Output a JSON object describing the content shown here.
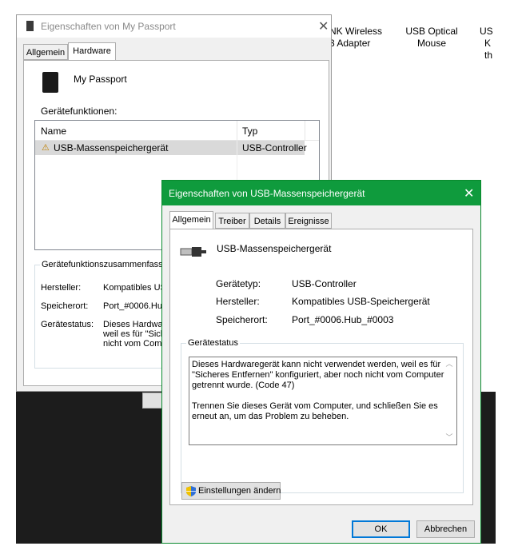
{
  "background": {
    "devices": [
      {
        "label_line1": "NK Wireless",
        "label_line2": "3 Adapter"
      },
      {
        "label_line1": "USB Optical",
        "label_line2": "Mouse"
      },
      {
        "label_line1": "US",
        "label_line2": "K",
        "label_line3": "th"
      }
    ]
  },
  "back_window": {
    "title": "Eigenschaften von My Passport",
    "tabs": [
      "Allgemein",
      "Hardware"
    ],
    "active_tab": "Hardware",
    "device_name": "My Passport",
    "functions_label": "Gerätefunktionen:",
    "columns": [
      "Name",
      "Typ"
    ],
    "rows": [
      {
        "name": "USB-Massenspeichergerät",
        "type": "USB-Controller"
      }
    ],
    "summary_title": "Gerätefunktionszusammenfassung",
    "summary": {
      "manufacturer_label": "Hersteller:",
      "manufacturer_value": "Kompatibles USB",
      "location_label": "Speicherort:",
      "location_value": "Port_#0006.Hub",
      "status_label": "Gerätestatus:",
      "status_line1": "Dieses Hardwa",
      "status_line2": "weil es für \"Siche",
      "status_line3": "nicht vom Comp"
    }
  },
  "front_window": {
    "title": "Eigenschaften von USB-Massenspeichergerät",
    "tabs": [
      "Allgemein",
      "Treiber",
      "Details",
      "Ereignisse"
    ],
    "active_tab": "Allgemein",
    "device_name": "USB-Massenspeichergerät",
    "props": {
      "type_label": "Gerätetyp:",
      "type_value": "USB-Controller",
      "manufacturer_label": "Hersteller:",
      "manufacturer_value": "Kompatibles USB-Speichergerät",
      "location_label": "Speicherort:",
      "location_value": "Port_#0006.Hub_#0003"
    },
    "status_group_title": "Gerätestatus",
    "status_line1": "Dieses Hardwaregerät kann nicht verwendet werden, weil es für",
    "status_line2": "\"Sicheres Entfernen\" konfiguriert, aber noch nicht vom Computer",
    "status_line3": "getrennt wurde. (Code 47)",
    "status_line4": "Trennen Sie dieses Gerät vom Computer, und schließen Sie es",
    "status_line5": "erneut an, um das Problem zu beheben.",
    "change_settings_button": "Einstellungen ändern",
    "ok_button": "OK",
    "cancel_button": "Abbrechen"
  },
  "colors": {
    "front_titlebar": "#0f9b3d",
    "selection_row": "#d9d9d9",
    "default_button_border": "#0078d7"
  }
}
